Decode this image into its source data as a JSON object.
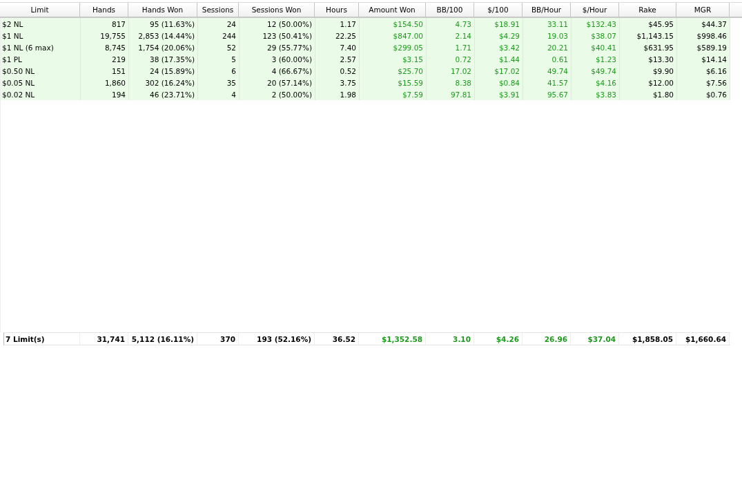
{
  "table": {
    "columns": [
      {
        "label": "Limit",
        "kind": "label"
      },
      {
        "label": "Hands",
        "kind": "number"
      },
      {
        "label": "Hands Won",
        "kind": "number"
      },
      {
        "label": "Sessions",
        "kind": "number"
      },
      {
        "label": "Sessions Won",
        "kind": "number"
      },
      {
        "label": "Hours",
        "kind": "number"
      },
      {
        "label": "Amount Won",
        "kind": "result"
      },
      {
        "label": "BB/100",
        "kind": "result"
      },
      {
        "label": "$/100",
        "kind": "result"
      },
      {
        "label": "BB/Hour",
        "kind": "result"
      },
      {
        "label": "$/Hour",
        "kind": "result"
      },
      {
        "label": "Rake",
        "kind": "number"
      },
      {
        "label": "MGR",
        "kind": "number"
      }
    ],
    "rows": [
      [
        "$2 NL",
        "817",
        "95 (11.63%)",
        "24",
        "12 (50.00%)",
        "1.17",
        "$154.50",
        "4.73",
        "$18.91",
        "33.11",
        "$132.43",
        "$45.95",
        "$44.37"
      ],
      [
        "$1 NL",
        "19,755",
        "2,853 (14.44%)",
        "244",
        "123 (50.41%)",
        "22.25",
        "$847.00",
        "2.14",
        "$4.29",
        "19.03",
        "$38.07",
        "$1,143.15",
        "$998.46"
      ],
      [
        "$1 NL (6 max)",
        "8,745",
        "1,754 (20.06%)",
        "52",
        "29 (55.77%)",
        "7.40",
        "$299.05",
        "1.71",
        "$3.42",
        "20.21",
        "$40.41",
        "$631.95",
        "$589.19"
      ],
      [
        "$1 PL",
        "219",
        "38 (17.35%)",
        "5",
        "3 (60.00%)",
        "2.57",
        "$3.15",
        "0.72",
        "$1.44",
        "0.61",
        "$1.23",
        "$13.30",
        "$14.14"
      ],
      [
        "$0.50 NL",
        "151",
        "24 (15.89%)",
        "6",
        "4 (66.67%)",
        "0.52",
        "$25.70",
        "17.02",
        "$17.02",
        "49.74",
        "$49.74",
        "$9.90",
        "$6.16"
      ],
      [
        "$0.05 NL",
        "1,860",
        "302 (16.24%)",
        "35",
        "20 (57.14%)",
        "3.75",
        "$15.59",
        "8.38",
        "$0.84",
        "41.57",
        "$4.16",
        "$12.00",
        "$7.56"
      ],
      [
        "$0.02 NL",
        "194",
        "46 (23.71%)",
        "4",
        "2 (50.00%)",
        "1.98",
        "$7.59",
        "97.81",
        "$3.91",
        "95.67",
        "$3.83",
        "$1.80",
        "$0.76"
      ]
    ],
    "totals": [
      "7 Limit(s)",
      "31,741",
      "5,112 (16.11%)",
      "370",
      "193 (52.16%)",
      "36.52",
      "$1,352.58",
      "3.10",
      "$4.26",
      "26.96",
      "$37.04",
      "$1,858.05",
      "$1,660.64"
    ]
  }
}
